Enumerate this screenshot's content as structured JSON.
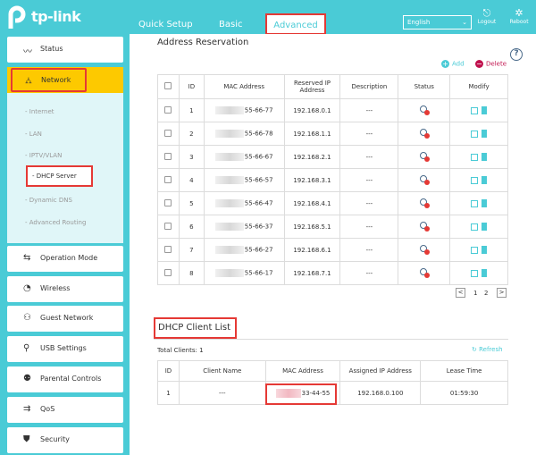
{
  "brand": {
    "logo_text": "tp-link",
    "accent": "#4acbd6",
    "highlight": "#fdc900",
    "alert": "#e53935"
  },
  "header": {
    "tabs": [
      {
        "label": "Quick Setup"
      },
      {
        "label": "Basic"
      },
      {
        "label": "Advanced",
        "active": true
      }
    ],
    "language": "English",
    "logout": "Logout",
    "reboot": "Reboot"
  },
  "sidebar": {
    "items": [
      {
        "label": "Status",
        "icon": "pulse-icon"
      },
      {
        "label": "Network",
        "icon": "network-icon",
        "active": true
      },
      {
        "label": "Operation Mode",
        "icon": "mode-icon"
      },
      {
        "label": "Wireless",
        "icon": "wifi-icon"
      },
      {
        "label": "Guest Network",
        "icon": "guest-icon"
      },
      {
        "label": "USB Settings",
        "icon": "usb-icon"
      },
      {
        "label": "Parental Controls",
        "icon": "parental-icon"
      },
      {
        "label": "QoS",
        "icon": "qos-icon"
      },
      {
        "label": "Security",
        "icon": "shield-icon"
      }
    ],
    "network_sub": [
      {
        "label": "- Internet"
      },
      {
        "label": "- LAN"
      },
      {
        "label": "- IPTV/VLAN"
      },
      {
        "label": "- DHCP Server",
        "active": true
      },
      {
        "label": "- Dynamic DNS"
      },
      {
        "label": "- Advanced Routing"
      }
    ]
  },
  "reservation": {
    "title": "Address Reservation",
    "add_label": "Add",
    "delete_label": "Delete",
    "columns": [
      "ID",
      "MAC Address",
      "Reserved IP Address",
      "Description",
      "Status",
      "Modify"
    ],
    "rows": [
      {
        "id": "1",
        "mac": "55-66-77",
        "ip": "192.168.0.1",
        "desc": "---"
      },
      {
        "id": "2",
        "mac": "55-66-78",
        "ip": "192.168.1.1",
        "desc": "---"
      },
      {
        "id": "3",
        "mac": "55-66-67",
        "ip": "192.168.2.1",
        "desc": "---"
      },
      {
        "id": "4",
        "mac": "55-66-57",
        "ip": "192.168.3.1",
        "desc": "---"
      },
      {
        "id": "5",
        "mac": "55-66-47",
        "ip": "192.168.4.1",
        "desc": "---"
      },
      {
        "id": "6",
        "mac": "55-66-37",
        "ip": "192.168.5.1",
        "desc": "---"
      },
      {
        "id": "7",
        "mac": "55-66-27",
        "ip": "192.168.6.1",
        "desc": "---"
      },
      {
        "id": "8",
        "mac": "55-66-17",
        "ip": "192.168.7.1",
        "desc": "---"
      }
    ],
    "pager": {
      "page1": "1",
      "page2": "2"
    }
  },
  "clients": {
    "title": "DHCP Client List",
    "total": "Total Clients: 1",
    "refresh": "Refresh",
    "columns": [
      "ID",
      "Client Name",
      "MAC Address",
      "Assigned IP Address",
      "Lease Time"
    ],
    "rows": [
      {
        "id": "1",
        "name": "---",
        "mac": "33-44-55",
        "ip": "192.168.0.100",
        "lease": "01:59:30"
      }
    ]
  }
}
